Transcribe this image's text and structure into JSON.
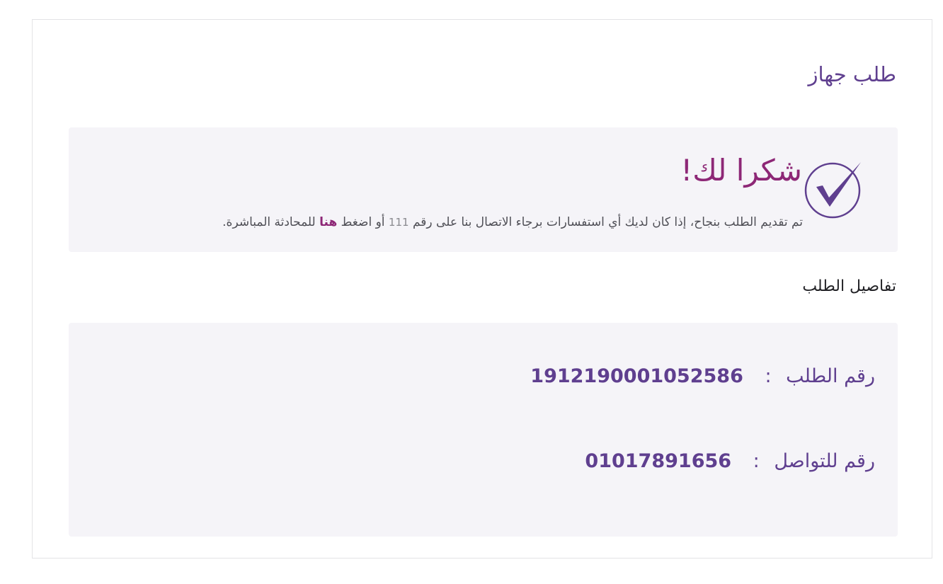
{
  "page": {
    "title": "طلب جهاز"
  },
  "success": {
    "title": "شكرا لك!",
    "message_before": "تم تقديم الطلب بنجاح، إذا كان لديك أي استفسارات برجاء الاتصال بنا على رقم",
    "hotline": "111",
    "message_middle": "أو اضغط",
    "link_label": "هنا",
    "message_after": "للمحادثة المباشرة.",
    "icon": "check-circle-icon",
    "accent_color": "#8d2776",
    "icon_color": "#5f3f8f"
  },
  "details": {
    "heading": "تفاصيل الطلب",
    "order_label": "رقم الطلب",
    "order_value": "1912190001052586",
    "contact_label": "رقم للتواصل",
    "contact_value": "01017891656",
    "separator": ":"
  },
  "colors": {
    "primary": "#5f3f8f",
    "accent": "#8d2776",
    "panel_bg": "#f5f4f8"
  }
}
